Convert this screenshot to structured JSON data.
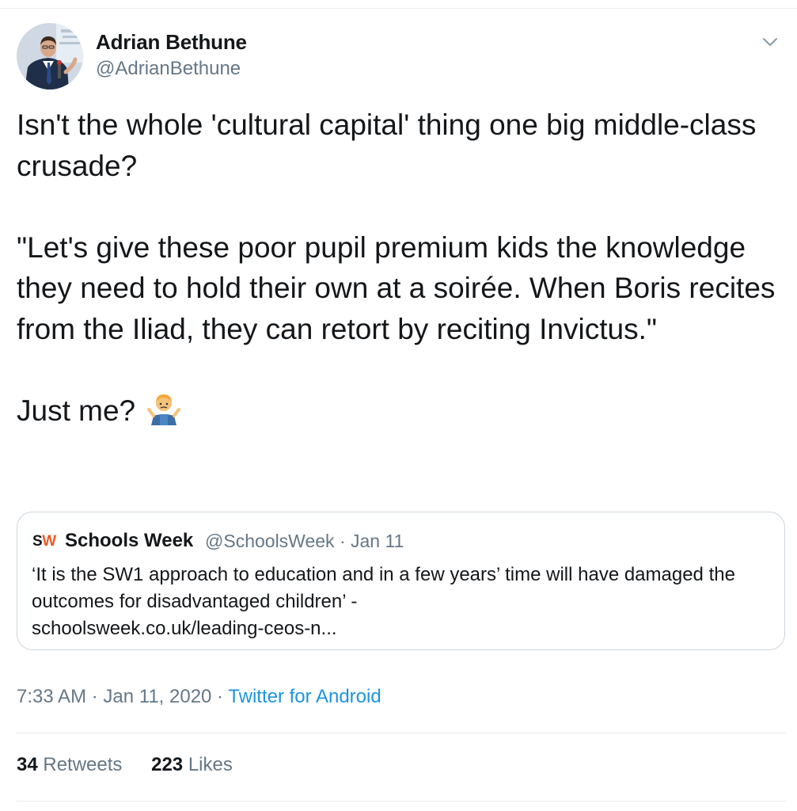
{
  "tweet": {
    "author": {
      "name": "Adrian Bethune",
      "handle": "@AdrianBethune"
    },
    "paragraphs": [
      "Isn't the whole 'cultural capital' thing one big middle-class crusade?",
      "\"Let's give these poor pupil premium kids the knowledge they need to hold their own at a soirée. When Boris recites from the Iliad,  they can retort by reciting Invictus.\"",
      "Just me?"
    ],
    "emoji": "man-shrugging-emoji",
    "quoted": {
      "logo_s": "S",
      "logo_w": "W",
      "name": "Schools Week",
      "handle": "@SchoolsWeek",
      "separator": "·",
      "date": "Jan 11",
      "text": "‘It is the SW1 approach to education and in a few years’ time will have damaged the outcomes for disadvantaged children’ -",
      "link": "schoolsweek.co.uk/leading-ceos-n..."
    },
    "timestamp": "7:33 AM · Jan 11, 2020 · ",
    "source": "Twitter for Android",
    "stats": {
      "retweets_count": "34",
      "retweets_label": "Retweets",
      "likes_count": "223",
      "likes_label": "Likes"
    }
  },
  "colors": {
    "link": "#1b95e0",
    "secondary_text": "#657786",
    "border": "#ccd6dd",
    "schools_week_accent": "#e85c25"
  },
  "icons": [
    "avatar-photo",
    "chevron-down-icon",
    "man-shrugging-emoji",
    "schools-week-logo"
  ]
}
